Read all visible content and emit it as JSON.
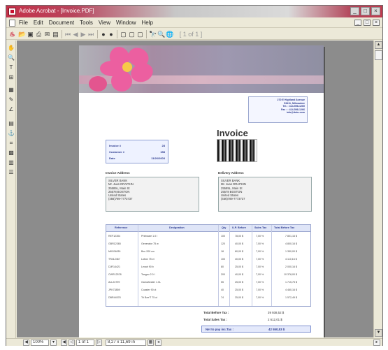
{
  "window": {
    "title": "Adobe Acrobat - [Invoice.PDF]",
    "win_buttons": [
      "_",
      "□",
      "×"
    ],
    "mdi_buttons": [
      "_",
      "□",
      "×"
    ]
  },
  "menu": [
    "File",
    "Edit",
    "Document",
    "Tools",
    "View",
    "Window",
    "Help"
  ],
  "toolbar": {
    "page_text": "[ 1 of 1 ]"
  },
  "status": {
    "zoom": "100%",
    "page": "1 of 1",
    "size": "8,27 x 11,69 in"
  },
  "invoice": {
    "title": "Invoice",
    "company_address": [
      "270 E Highland Avenue",
      "53411, Milwaukee",
      "Tel. : 414-598-1260",
      "Fax : : 414-598-1266",
      "info@dotu.com"
    ],
    "info": [
      {
        "label": "Invoice #",
        "value": "28"
      },
      {
        "label": "Customer #",
        "value": "158"
      },
      {
        "label": "Date",
        "value": "11/26/2003"
      }
    ],
    "invoice_address_label": "Invoice Address",
    "delivery_address_label": "Delivery Address",
    "invoice_address": [
      "SILVER BANK",
      "Mr. Juan DRAPKIN",
      "25589L, Main St",
      "25578 BOSTON",
      "United States",
      "(456)789-7773737"
    ],
    "delivery_address": [
      "SILVER BANK",
      "Mr. Juan DRAPKIN",
      "25589L, Main St",
      "25578 BOSTON",
      "United States",
      "(456)789-7773737"
    ],
    "columns": [
      "Reference",
      "Designation",
      "Qty",
      "U.P. Before",
      "Sales Tax",
      "Total Before Tax"
    ],
    "rows": [
      [
        "REF12304",
        "Printware 1.0 I",
        "100",
        "78,00 $",
        "7,00 %",
        "7 801,16 $"
      ],
      [
        "GBR12365",
        "Generator 75 w",
        "120",
        "40,00 $",
        "7,00 %",
        "4 800,16 $"
      ],
      [
        "MK024839",
        "Box 200 cm",
        "18",
        "80,00 $",
        "7,00 %",
        "1 350,00 $"
      ],
      [
        "TR412467",
        "Lobox 75 ct",
        "100",
        "40,00 $",
        "7,00 %",
        "4 110,16 $"
      ],
      [
        "DJR14421",
        "Lexah 90 b",
        "80",
        "25,00 $",
        "7,00 %",
        "2 000,16 $"
      ],
      [
        "CWR12578",
        "Tangso 2.0 I",
        "200",
        "40,00 $",
        "7,00 %",
        "10 378,00 $"
      ],
      [
        "ALL24799",
        "Gamaheater 1.0L",
        "55",
        "25,00 $",
        "7,00 %",
        "1 715,75 $"
      ],
      [
        "JPK73859",
        "Coaster 90 ct",
        "40",
        "25,00 $",
        "7,00 %",
        "4 460,16 $"
      ],
      [
        "DBR44578",
        "Tri Bee'T 75 ct",
        "74",
        "25,00 $",
        "7,00 %",
        "1 572,49 $"
      ]
    ],
    "totals": [
      {
        "label": "Total Before Tax :",
        "value": "39 938,52 $"
      },
      {
        "label": "Total Sales Tax :",
        "value": "2 612,01 $"
      }
    ],
    "net": {
      "label": "Net to pay inc.Tax :",
      "value": "42 550,53 $"
    }
  }
}
